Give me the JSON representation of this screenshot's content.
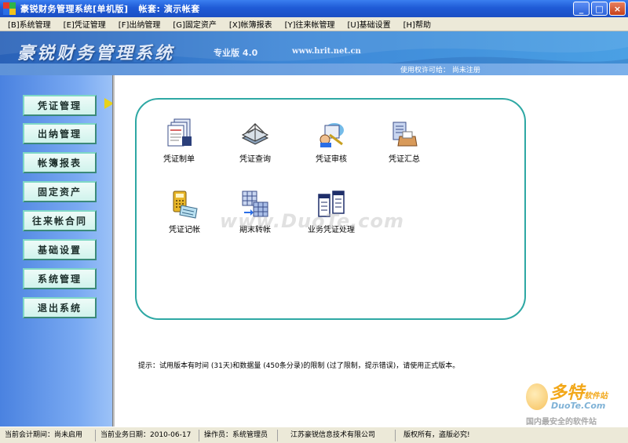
{
  "window": {
    "title": "豪锐财务管理系统[单机版]   帐套: 演示帐套",
    "minimize_label": "_",
    "maximize_label": "□",
    "close_label": "×"
  },
  "menu": [
    {
      "label": "[B]系统管理"
    },
    {
      "label": "[E]凭证管理"
    },
    {
      "label": "[F]出纳管理"
    },
    {
      "label": "[G]固定资产"
    },
    {
      "label": "[X]帐簿报表"
    },
    {
      "label": "[Y]往来帐管理"
    },
    {
      "label": "[U]基础设置"
    },
    {
      "label": "[H]帮助"
    }
  ],
  "banner": {
    "title": "豪锐财务管理系统",
    "edition": "专业版 4.0",
    "url": "www.hrit.net.cn",
    "license": "使用权许可给：  尚未注册"
  },
  "nav": [
    {
      "label": "凭证管理"
    },
    {
      "label": "出纳管理"
    },
    {
      "label": "帐簿报表"
    },
    {
      "label": "固定资产"
    },
    {
      "label": "往来帐合同"
    },
    {
      "label": "基础设置"
    },
    {
      "label": "系统管理"
    },
    {
      "label": "退出系统"
    }
  ],
  "functions": [
    {
      "label": "凭证制单",
      "icon": "voucher-entry-icon"
    },
    {
      "label": "凭证查询",
      "icon": "voucher-query-icon"
    },
    {
      "label": "凭证审核",
      "icon": "voucher-audit-icon"
    },
    {
      "label": "凭证汇总",
      "icon": "voucher-summary-icon"
    },
    {
      "label": "凭证记帐",
      "icon": "voucher-posting-icon"
    },
    {
      "label": "期末转帐",
      "icon": "period-transfer-icon"
    },
    {
      "label": "业务凭证处理",
      "icon": "business-voucher-icon"
    }
  ],
  "tip": "提示：试用版本有时间 (31天)和数据量 (450条分录)的限制 (过了限制，提示错误)，请使用正式版本。",
  "watermark": "www.DuoTe.com",
  "logo": {
    "line1": "多特",
    "line1_small": "软件站",
    "line2": "DuoTe.Com",
    "line3": "国内最安全的软件站"
  },
  "status": {
    "period": "当前会计期间：尚未启用",
    "date": "当前业务日期：2010-06-17",
    "operator": "操作员：系统管理员",
    "company": "江苏豪锐信息技术有限公司",
    "copyright": "版权所有，盗版必究!"
  },
  "colors": {
    "titlebar": "#1f5bd6",
    "banner": "#3d86d6",
    "nav_button": "#d0f3ec",
    "panel_border": "#2ea8a4"
  }
}
